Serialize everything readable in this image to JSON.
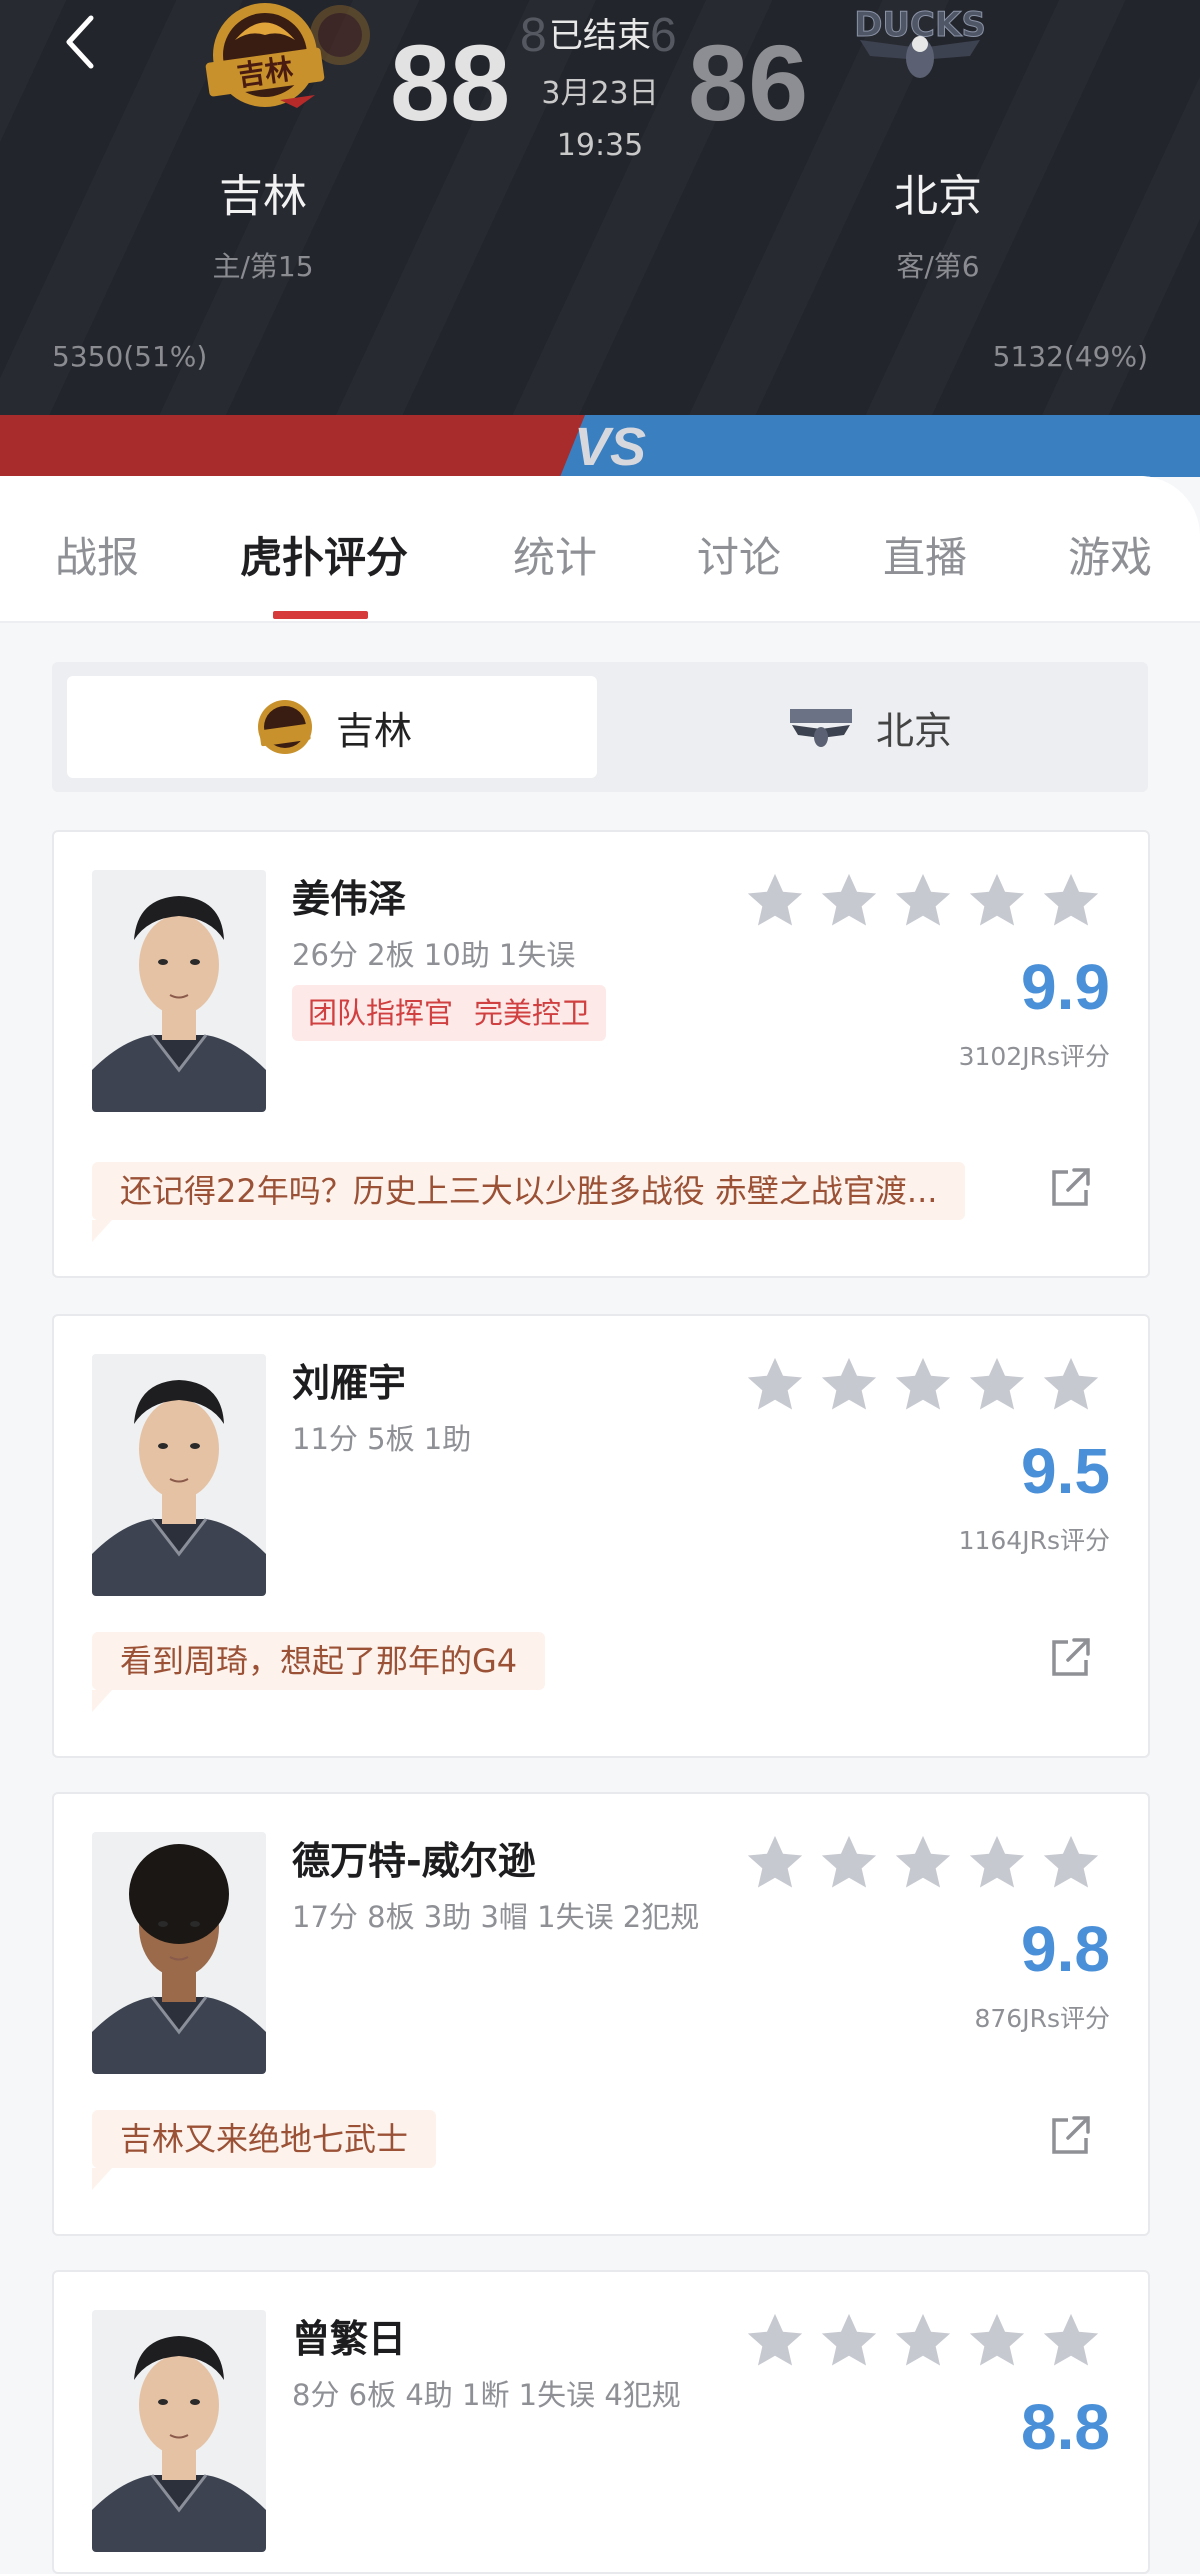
{
  "header": {
    "status": "已结束",
    "date": "3月23日",
    "time": "19:35",
    "home": {
      "name": "吉林",
      "rank": "主/第15",
      "score": "88",
      "support": "5350(51%)",
      "logo_text": "吉林"
    },
    "away": {
      "name": "北京",
      "rank": "客/第6",
      "score": "86",
      "support": "5132(49%)",
      "logo_text": "DUCKS"
    },
    "ghost_score_left": "8",
    "ghost_score_right": "6",
    "vs_text": "VS",
    "colors": {
      "home": "#a72c2b",
      "away": "#3a7fc0"
    }
  },
  "tabs": [
    "战报",
    "虎扑评分",
    "统计",
    "讨论",
    "直播",
    "游戏"
  ],
  "active_tab": "虎扑评分",
  "team_switch": {
    "home": "吉林",
    "away": "北京",
    "selected": "吉林"
  },
  "players": [
    {
      "name": "姜伟泽",
      "stats": "26分 2板 10助 1失误",
      "tags": [
        "团队指挥官",
        "完美控卫"
      ],
      "rating": "9.9",
      "count": "3102JRs评分",
      "comment": "还记得22年吗？历史上三大以少胜多战役 赤壁之战官渡..."
    },
    {
      "name": "刘雁宇",
      "stats": "11分 5板 1助",
      "tags": [],
      "rating": "9.5",
      "count": "1164JRs评分",
      "comment": "看到周琦，想起了那年的G4"
    },
    {
      "name": "德万特-威尔逊",
      "stats": "17分 8板 3助 3帽 1失误 2犯规",
      "tags": [],
      "rating": "9.8",
      "count": "876JRs评分",
      "comment": "吉林又来绝地七武士"
    },
    {
      "name": "曾繁日",
      "stats": "8分 6板 4助 1断 1失误 4犯规",
      "tags": [],
      "rating": "8.8",
      "count": "",
      "comment": ""
    }
  ],
  "icons": {
    "back": "chevron-left-icon",
    "star": "star-icon",
    "share": "share-icon"
  },
  "accent": "#4a90d9"
}
